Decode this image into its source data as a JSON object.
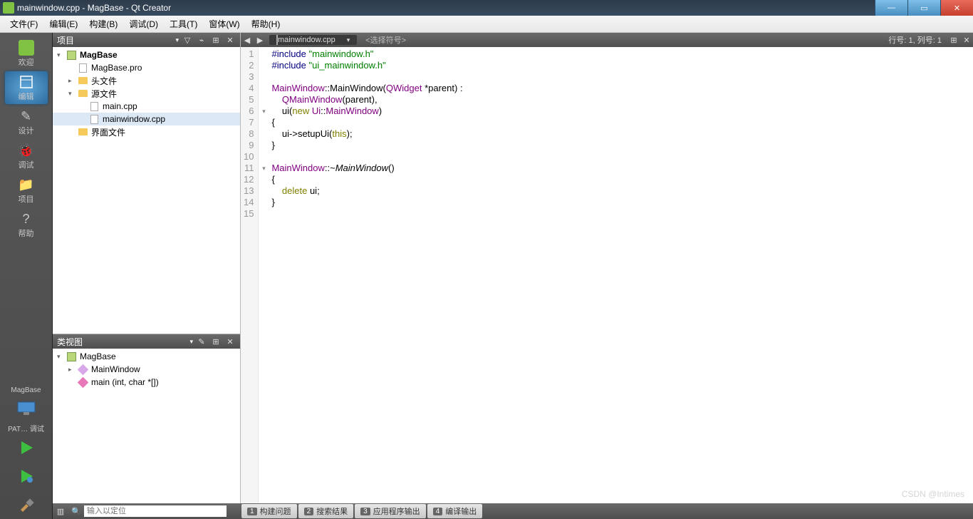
{
  "window": {
    "title": "mainwindow.cpp - MagBase - Qt Creator"
  },
  "menu": [
    "文件(F)",
    "编辑(E)",
    "构建(B)",
    "调试(D)",
    "工具(T)",
    "窗体(W)",
    "帮助(H)"
  ],
  "activity": [
    {
      "label": "欢迎",
      "active": false,
      "icon": "qt"
    },
    {
      "label": "编辑",
      "active": true,
      "icon": "edit"
    },
    {
      "label": "设计",
      "active": false,
      "icon": "design"
    },
    {
      "label": "调试",
      "active": false,
      "icon": "debug"
    },
    {
      "label": "项目",
      "active": false,
      "icon": "project"
    },
    {
      "label": "帮助",
      "active": false,
      "icon": "help"
    }
  ],
  "projectLabel": "MagBase",
  "runConfig": "PAT… 调试",
  "projectPanel": {
    "title": "项目"
  },
  "projectTree": [
    {
      "indent": 0,
      "exp": "▾",
      "icon": "proj",
      "label": "MagBase",
      "bold": true
    },
    {
      "indent": 1,
      "exp": "",
      "icon": "file",
      "label": "MagBase.pro"
    },
    {
      "indent": 1,
      "exp": "▸",
      "icon": "folder",
      "label": "头文件"
    },
    {
      "indent": 1,
      "exp": "▾",
      "icon": "folder",
      "label": "源文件"
    },
    {
      "indent": 2,
      "exp": "",
      "icon": "file",
      "label": "main.cpp"
    },
    {
      "indent": 2,
      "exp": "",
      "icon": "file",
      "label": "mainwindow.cpp",
      "selected": true
    },
    {
      "indent": 1,
      "exp": "",
      "icon": "folder",
      "label": "界面文件"
    }
  ],
  "classPanel": {
    "title": "类视图"
  },
  "classTree": [
    {
      "indent": 0,
      "exp": "▾",
      "icon": "proj",
      "label": "MagBase"
    },
    {
      "indent": 1,
      "exp": "▸",
      "icon": "diamond",
      "label": "MainWindow"
    },
    {
      "indent": 1,
      "exp": "",
      "icon": "pink",
      "label": "main (int, char *[])"
    }
  ],
  "editor": {
    "filename": "mainwindow.cpp",
    "symbolPlaceholder": "<选择符号>",
    "cursor": "行号: 1, 列号: 1",
    "lines": 15,
    "code": [
      {
        "html": "<span class='pp'>#include</span> <span class='str'>\"mainwindow.h\"</span>"
      },
      {
        "html": "<span class='pp'>#include</span> <span class='str'>\"ui_mainwindow.h\"</span>"
      },
      {
        "html": ""
      },
      {
        "html": "<span class='type'>MainWindow</span>::<span>MainWindow</span>(<span class='type'>QWidget</span> *parent) :"
      },
      {
        "html": "    <span class='type'>QMainWindow</span>(parent),"
      },
      {
        "html": "    ui(<span class='kw'>new</span> <span class='type'>Ui</span>::<span class='type'>MainWindow</span>)",
        "fold": "▾"
      },
      {
        "html": "{"
      },
      {
        "html": "    ui-&gt;setupUi(<span class='kw'>this</span>);"
      },
      {
        "html": "}"
      },
      {
        "html": ""
      },
      {
        "html": "<span class='type'>MainWindow</span>::~<span class='it'>MainWindow</span>()",
        "fold": "▾"
      },
      {
        "html": "{"
      },
      {
        "html": "    <span class='kw'>delete</span> ui;"
      },
      {
        "html": "}"
      },
      {
        "html": ""
      }
    ]
  },
  "searchPlaceholder": "输入以定位",
  "bottomTabs": [
    {
      "num": "1",
      "label": "构建问题"
    },
    {
      "num": "2",
      "label": "搜索结果"
    },
    {
      "num": "3",
      "label": "应用程序输出"
    },
    {
      "num": "4",
      "label": "编译输出"
    }
  ],
  "watermark": "CSDN @Intimes"
}
